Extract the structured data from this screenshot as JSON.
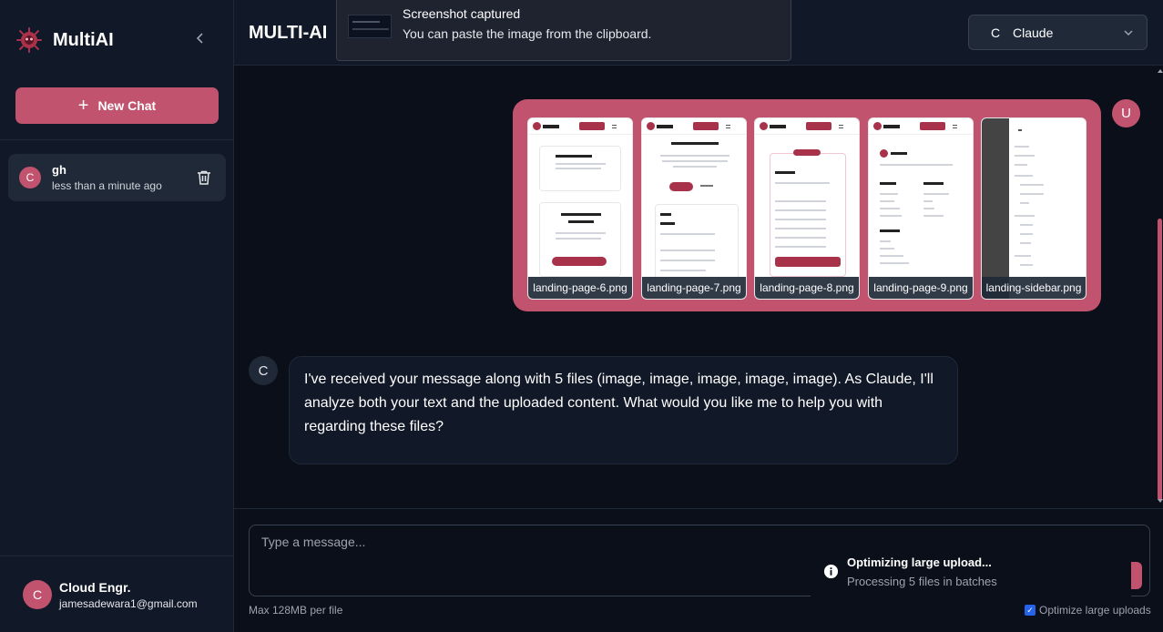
{
  "sidebar": {
    "brand": "MultiAI",
    "new_chat_label": "New Chat",
    "chats": [
      {
        "initial": "C",
        "title": "gh",
        "time": "less than a minute ago"
      }
    ],
    "user": {
      "initial": "C",
      "name": "Cloud Engr.",
      "email": "jamesadewara1@gmail.com"
    }
  },
  "header": {
    "title": "MULTI-AI",
    "model": {
      "initial": "C",
      "name": "Claude"
    }
  },
  "notification": {
    "title": "Screenshot captured",
    "message": "You can paste the image from the clipboard."
  },
  "conversation": {
    "user_initial": "U",
    "attachments": [
      {
        "name": "landing-page-6.png"
      },
      {
        "name": "landing-page-7.png"
      },
      {
        "name": "landing-page-8.png"
      },
      {
        "name": "landing-page-9.png"
      },
      {
        "name": "landing-sidebar.png"
      }
    ],
    "assistant_initial": "C",
    "assistant_message": "I've received your message along with 5 files (image, image, image, image, image). As Claude, I'll analyze both your text and the uploaded content. What would you like me to help you with regarding these files?"
  },
  "composer": {
    "placeholder": "Type a message...",
    "limit_text": "Max 128MB per file",
    "optimize_label": "Optimize large uploads",
    "optimize_checked": true
  },
  "upload_toast": {
    "title": "Optimizing large upload...",
    "message": "Processing 5 files in batches"
  },
  "colors": {
    "accent": "#c2536f",
    "background": "#0b0f19",
    "panel": "#111827"
  },
  "icons": [
    "brand-logo-icon",
    "chevron-left-icon",
    "plus-icon",
    "trash-icon",
    "chevron-down-icon",
    "info-icon",
    "checkbox-check-icon"
  ]
}
